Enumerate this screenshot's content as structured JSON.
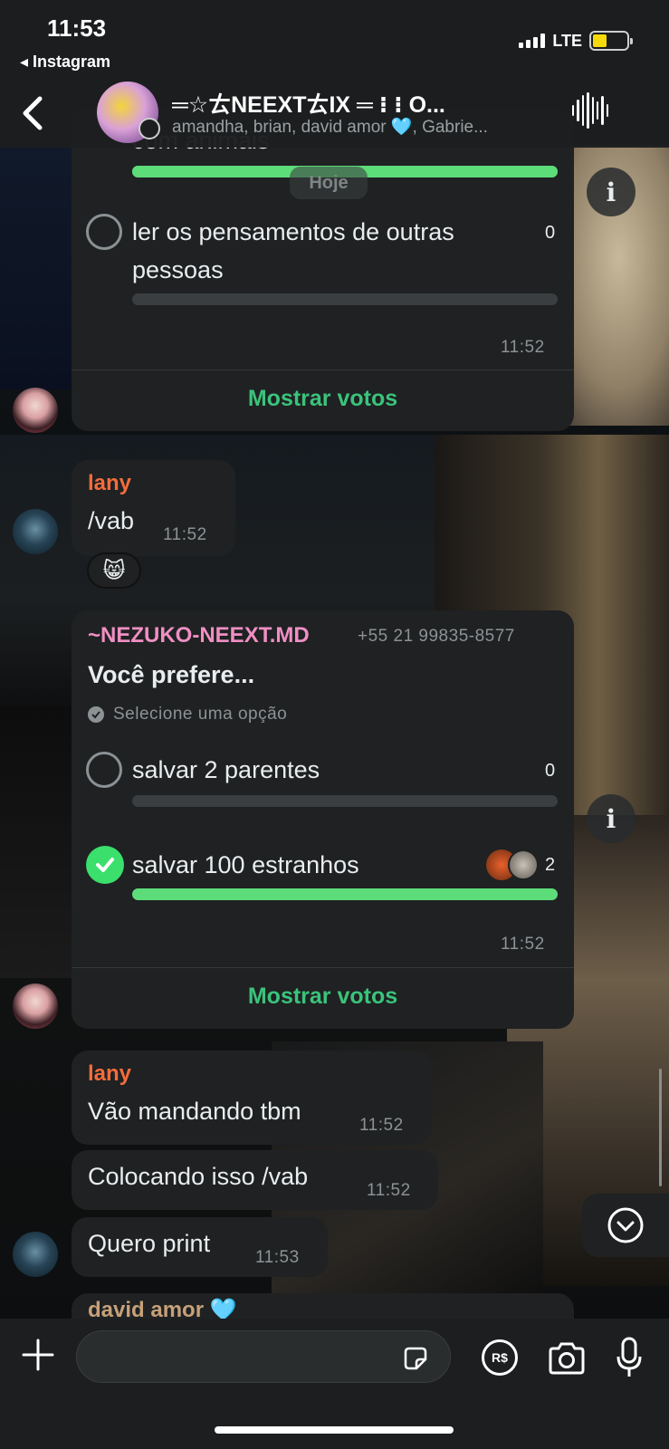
{
  "status_bar": {
    "time": "11:53",
    "back_app": "◂ Instagram",
    "network": "LTE",
    "battery_level": 0.42
  },
  "header": {
    "group_name": "═☆ㄊNEEXTㄊIX ═ ⁝ ⁝ O...",
    "members": "amandha, brian, david amor 🩵, Gabrie..."
  },
  "chat": {
    "date_chip": "Hoje",
    "poll1": {
      "partial_option": "com animais",
      "partial_fill": 1.0,
      "option_text": "ler os pensamentos de outras pessoas",
      "option_count": "0",
      "option_fill": 0.0,
      "time": "11:52",
      "show_votes": "Mostrar votos"
    },
    "msg_lany_1": {
      "sender": "lany",
      "text": "/vab",
      "time": "11:52",
      "reaction": "😸"
    },
    "poll2": {
      "sender": "~NEZUKO-NEEXT.MD",
      "phone": "+55 21 99835-8577",
      "question": "Você prefere...",
      "hint": "Selecione uma opção",
      "options": [
        {
          "text": "salvar 2 parentes",
          "count": "0",
          "fill": 0.0,
          "selected": false
        },
        {
          "text": "salvar 100 estranhos",
          "count": "2",
          "fill": 1.0,
          "selected": true
        }
      ],
      "time": "11:52",
      "show_votes": "Mostrar votos"
    },
    "msg_lany_2": {
      "sender": "lany",
      "text": "Vão mandando tbm",
      "time": "11:52"
    },
    "msg_lany_3": {
      "text": "Colocando isso /vab",
      "time": "11:52"
    },
    "msg_lany_4": {
      "text": "Quero print",
      "time": "11:53"
    },
    "partial_sender": "david amor 🩵"
  },
  "input": {
    "placeholder": "",
    "pay_label": "R$"
  },
  "colors": {
    "poll_fill": "#5ddc7a",
    "show_votes": "#3ac37b",
    "lany_name": "#f26d3d",
    "nezuko_name": "#f08fc4"
  },
  "icons": {
    "back": "chevron-left-icon",
    "audio": "waveform-icon",
    "info": "info-icon",
    "check": "check-icon",
    "scroll": "chevron-down-icon",
    "plus": "plus-icon",
    "sticker": "sticker-icon",
    "camera": "camera-icon",
    "mic": "mic-icon"
  }
}
